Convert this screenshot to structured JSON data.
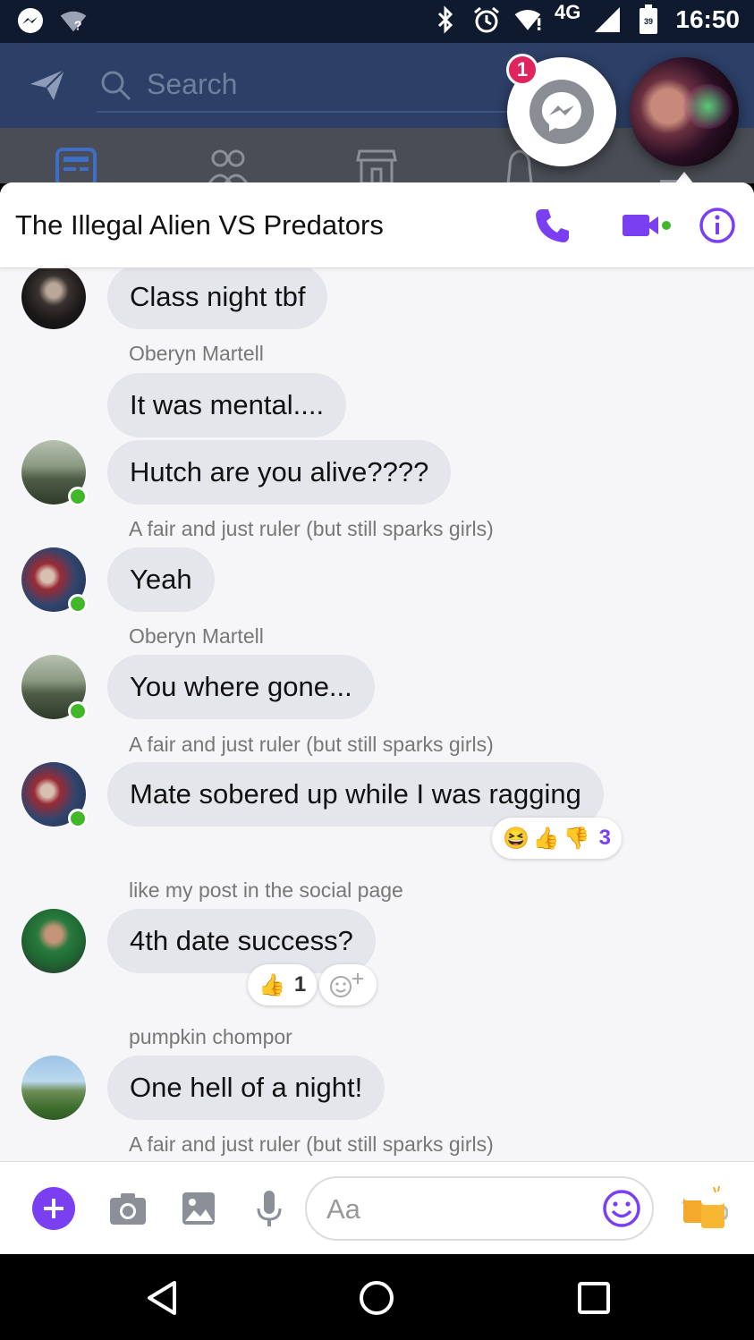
{
  "status_bar": {
    "time": "16:50",
    "network": "4G",
    "battery_level": "39",
    "icons": [
      "messenger-icon",
      "wifi-question-icon",
      "bluetooth-icon",
      "alarm-icon",
      "wifi-icon",
      "signal-icon",
      "battery-icon"
    ]
  },
  "background_app": {
    "search_placeholder": "Search"
  },
  "chat_head": {
    "badge_count": "1"
  },
  "conversation": {
    "title": "The Illegal Alien VS Predators",
    "accent_color": "#7b3ff2"
  },
  "messages": [
    {
      "sender": "",
      "text": "Class night tbf"
    },
    {
      "sender": "Oberyn Martell",
      "text": "It was mental...."
    },
    {
      "sender": "",
      "text": "Hutch are you alive????"
    },
    {
      "sender": "A fair and just ruler (but still sparks girls)",
      "text": "Yeah"
    },
    {
      "sender": "Oberyn Martell",
      "text": "You where gone..."
    },
    {
      "sender": "A fair and just ruler (but still sparks girls)",
      "text": "Mate sobered up while I was ragging",
      "reaction_count": "3"
    },
    {
      "sender": "like my post in the social page",
      "text": "4th date success?",
      "reaction_count": "1"
    },
    {
      "sender": "pumpkin chompor",
      "text": "One hell of a night!"
    },
    {
      "sender": "A fair and just ruler (but still sparks girls)",
      "text": ""
    }
  ],
  "composer": {
    "placeholder": "Aa"
  }
}
